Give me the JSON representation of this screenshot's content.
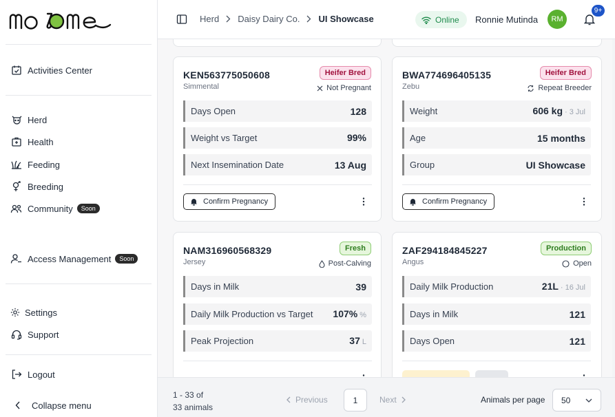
{
  "app": {
    "logo_text": "mooome"
  },
  "sidebar": {
    "items": [
      {
        "label": "Activities Center",
        "icon": "calendar-check-icon"
      },
      {
        "label": "Herd",
        "icon": "cow-icon"
      },
      {
        "label": "Health",
        "icon": "medical-kit-icon"
      },
      {
        "label": "Feeding",
        "icon": "grass-icon"
      },
      {
        "label": "Breeding",
        "icon": "gender-icon"
      },
      {
        "label": "Community",
        "icon": "people-icon",
        "badge": "Soon"
      },
      {
        "label": "Access Management",
        "icon": "user-key-icon",
        "badge": "Soon"
      },
      {
        "label": "Settings",
        "icon": "gear-icon"
      },
      {
        "label": "Support",
        "icon": "headset-icon"
      },
      {
        "label": "Logout",
        "icon": "logout-icon"
      }
    ],
    "collapse_label": "Collapse menu"
  },
  "header": {
    "breadcrumb": [
      "Herd",
      "Daisy Dairy Co.",
      "UI Showcase"
    ],
    "online_label": "Online",
    "user_name": "Ronnie Mutinda",
    "avatar_initials": "RM",
    "notifications_badge": "9+"
  },
  "cards": [
    {
      "tag": "KEN563775050608",
      "breed": "Simmental",
      "status": "Heifer Bred",
      "substatus": "Not Pregnant",
      "substatus_icon": "x-icon",
      "metrics": [
        {
          "label": "Days Open",
          "value": "128",
          "sub": ""
        },
        {
          "label": "Weight vs Target",
          "value": "99%",
          "sub": "%"
        },
        {
          "label": "Next Insemination Date",
          "value": "13 Aug",
          "sub": ""
        }
      ],
      "action": "Confirm Pregnancy"
    },
    {
      "tag": "BWA774696405135",
      "breed": "Zebu",
      "status": "Heifer Bred",
      "substatus": "Repeat Breeder",
      "substatus_icon": "repeat-icon",
      "metrics": [
        {
          "label": "Weight",
          "value": "606 kg",
          "sub": "· 3 Jul"
        },
        {
          "label": "Age",
          "value": "15 months",
          "sub": ""
        },
        {
          "label": "Group",
          "value": "UI Showcase",
          "sub": ""
        }
      ],
      "action": "Confirm Pregnancy"
    },
    {
      "tag": "NAM316960568329",
      "breed": "Jersey",
      "status": "Fresh",
      "substatus": "Post-Calving",
      "substatus_icon": "drop-icon",
      "metrics": [
        {
          "label": "Days in Milk",
          "value": "39",
          "sub": ""
        },
        {
          "label": "Daily Milk Production vs Target",
          "value": "107%",
          "sub": "%"
        },
        {
          "label": "Peak Projection",
          "value": "37",
          "sub": "L"
        }
      ]
    },
    {
      "tag": "ZAF294184845227",
      "breed": "Angus",
      "status": "Production",
      "substatus": "Open",
      "substatus_icon": "circle-icon",
      "metrics": [
        {
          "label": "Daily Milk Production",
          "value": "21L",
          "sub": "· 16 Jul"
        },
        {
          "label": "Days in Milk",
          "value": "121",
          "sub": ""
        },
        {
          "label": "Days Open",
          "value": "121",
          "sub": ""
        }
      ]
    }
  ],
  "pagination": {
    "range_line1": "1 - 33 of",
    "range_line2": "33 animals",
    "prev_label": "Previous",
    "current_page": "1",
    "next_label": "Next",
    "per_page_label": "Animals per page",
    "per_page_value": "50"
  },
  "colors": {
    "online_bg": "#e9f7ee",
    "online_text": "#1f8b4c",
    "avatar": "#5ab12f",
    "badge": "#1e55c8"
  }
}
